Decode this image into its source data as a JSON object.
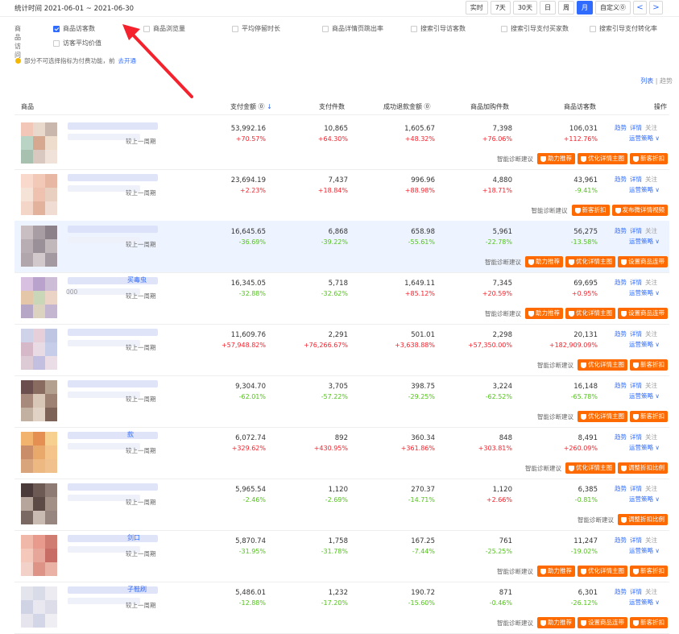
{
  "header": {
    "stat_time": "统计时间 2021-06-01 ~ 2021-06-30",
    "ranges": [
      "实时",
      "7天",
      "30天",
      "日",
      "周",
      "月",
      "自定义⓪"
    ],
    "active_range": "月",
    "prev": "<",
    "next": ">"
  },
  "metrics": {
    "label": "商品访问",
    "items": [
      {
        "label": "商品访客数",
        "checked": true
      },
      {
        "label": "商品浏览量",
        "checked": false
      },
      {
        "label": "平均停留时长",
        "checked": false
      },
      {
        "label": "商品详情页跳出率",
        "checked": false
      },
      {
        "label": "搜索引导访客数",
        "checked": false
      },
      {
        "label": "搜索引导支付买家数",
        "checked": false
      },
      {
        "label": "搜索引导支付转化率",
        "checked": false
      },
      {
        "label": "访客平均价值",
        "checked": false
      }
    ]
  },
  "notice": {
    "text": "部分不可选择指标为付费功能，前",
    "link": "去开通"
  },
  "view": {
    "list": "列表",
    "sep": "|",
    "chart": "趋势"
  },
  "columns": [
    "商品",
    "支付金额 ⓪",
    "支付件数",
    "成功退款金额 ⓪",
    "商品加购件数",
    "商品访客数",
    "操作"
  ],
  "compare_label": "较上一周期",
  "ops": {
    "trend": "趋势",
    "detail": "详情",
    "follow": "关注",
    "strategy": "运营策略 ∨"
  },
  "diag_label": "智能诊断建议",
  "rows": [
    {
      "extra": "",
      "sub": "",
      "pay": "53,992.16",
      "pay_d": "+70.57%",
      "qty": "10,865",
      "qty_d": "+64.30%",
      "refund": "1,605.67",
      "refund_d": "+48.32%",
      "cart": "7,398",
      "cart_d": "+76.06%",
      "visitors": "106,031",
      "visitors_d": "+112.76%",
      "actions": [
        "助力推荐",
        "优化详情主图",
        "新客折扣"
      ]
    },
    {
      "extra": "",
      "sub": "",
      "pay": "23,694.19",
      "pay_d": "+2.23%",
      "qty": "7,437",
      "qty_d": "+18.84%",
      "refund": "996.96",
      "refund_d": "+88.98%",
      "cart": "4,880",
      "cart_d": "+18.71%",
      "visitors": "43,961",
      "visitors_d": "-9.41%",
      "actions": [
        "新客折扣",
        "发布微详情视频"
      ]
    },
    {
      "extra": "",
      "sub": "",
      "pay": "16,645.65",
      "pay_d": "-36.69%",
      "qty": "6,868",
      "qty_d": "-39.22%",
      "refund": "658.98",
      "refund_d": "-55.61%",
      "cart": "5,961",
      "cart_d": "-22.78%",
      "visitors": "56,275",
      "visitors_d": "-13.58%",
      "actions": [
        "助力推荐",
        "优化详情主图",
        "设置商品连带"
      ]
    },
    {
      "extra": "买毒虫",
      "sub": "000",
      "pay": "16,345.05",
      "pay_d": "-32.88%",
      "qty": "5,718",
      "qty_d": "-32.62%",
      "refund": "1,649.11",
      "refund_d": "+85.12%",
      "cart": "7,345",
      "cart_d": "+20.59%",
      "visitors": "69,695",
      "visitors_d": "+0.95%",
      "actions": [
        "助力推荐",
        "优化详情主图",
        "设置商品连带"
      ]
    },
    {
      "extra": "",
      "sub": "",
      "pay": "11,609.76",
      "pay_d": "+57,948.82%",
      "qty": "2,291",
      "qty_d": "+76,266.67%",
      "refund": "501.01",
      "refund_d": "+3,638.88%",
      "cart": "2,298",
      "cart_d": "+57,350.00%",
      "visitors": "20,131",
      "visitors_d": "+182,909.09%",
      "actions": [
        "优化详情主图",
        "新客折扣"
      ]
    },
    {
      "extra": "",
      "sub": "",
      "pay": "9,304.70",
      "pay_d": "-62.01%",
      "qty": "3,705",
      "qty_d": "-57.22%",
      "refund": "398.75",
      "refund_d": "-29.25%",
      "cart": "3,224",
      "cart_d": "-62.52%",
      "visitors": "16,148",
      "visitors_d": "-65.78%",
      "actions": [
        "优化详情主图",
        "新客折扣"
      ]
    },
    {
      "extra": "款",
      "sub": "",
      "pay": "6,072.74",
      "pay_d": "+329.62%",
      "qty": "892",
      "qty_d": "+430.95%",
      "refund": "360.34",
      "refund_d": "+361.86%",
      "cart": "848",
      "cart_d": "+303.81%",
      "visitors": "8,491",
      "visitors_d": "+260.09%",
      "actions": [
        "优化详情主图",
        "调整折扣比例"
      ]
    },
    {
      "extra": "",
      "sub": "",
      "pay": "5,965.54",
      "pay_d": "-2.46%",
      "qty": "1,120",
      "qty_d": "-2.69%",
      "refund": "270.37",
      "refund_d": "-14.71%",
      "cart": "1,120",
      "cart_d": "+2.66%",
      "visitors": "6,385",
      "visitors_d": "-0.81%",
      "actions": [
        "调整折扣比例"
      ]
    },
    {
      "extra": "剑口",
      "sub": "",
      "pay": "5,870.74",
      "pay_d": "-31.95%",
      "qty": "1,758",
      "qty_d": "-31.78%",
      "refund": "167.25",
      "refund_d": "-7.44%",
      "cart": "761",
      "cart_d": "-25.25%",
      "visitors": "11,247",
      "visitors_d": "-19.02%",
      "actions": [
        "助力推荐",
        "优化详情主图",
        "新客折扣"
      ]
    },
    {
      "extra": "子鞋刷",
      "sub": "",
      "pay": "5,486.01",
      "pay_d": "-12.88%",
      "qty": "1,232",
      "qty_d": "-17.20%",
      "refund": "190.72",
      "refund_d": "-15.60%",
      "cart": "871",
      "cart_d": "-0.46%",
      "visitors": "6,301",
      "visitors_d": "-26.12%",
      "actions": [
        "助力推荐",
        "设置商品连带",
        "新客折扣"
      ]
    }
  ],
  "colors": {
    "accent": "#2f6bff",
    "orange": "#ff6a00",
    "up": "#f5222d",
    "down": "#52c41a",
    "highlight": "#eef4ff"
  }
}
